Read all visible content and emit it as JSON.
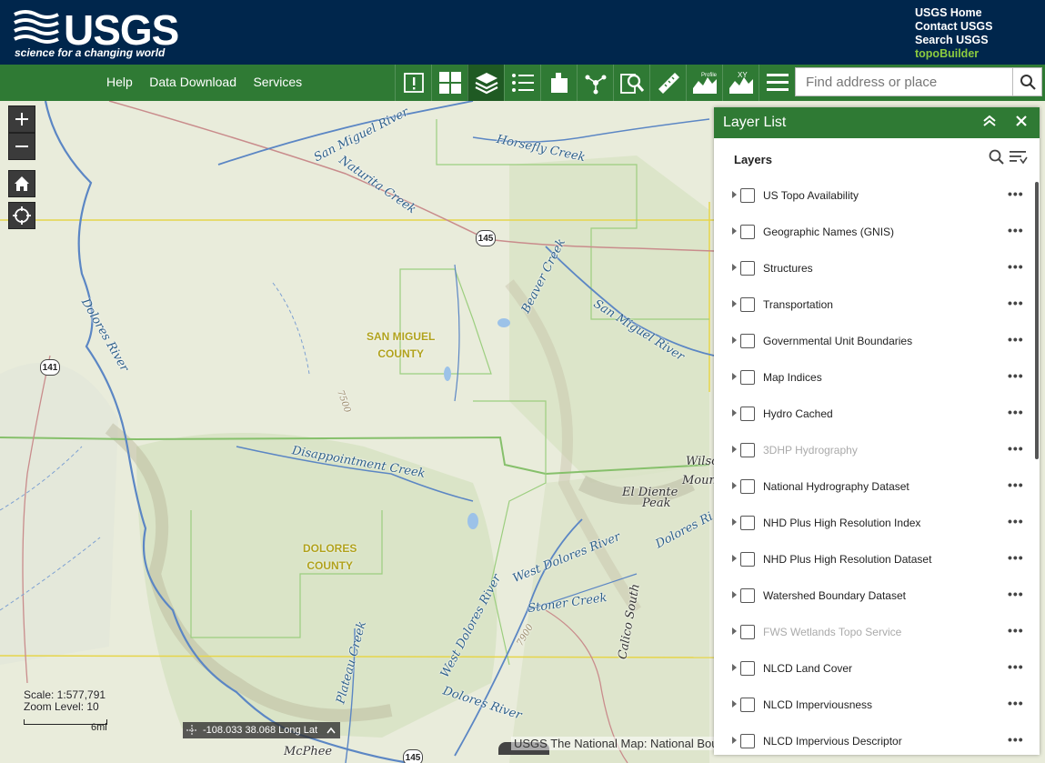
{
  "header": {
    "logo_word": "USGS",
    "logo_tagline": "science for a changing world",
    "links": [
      "USGS Home",
      "Contact USGS",
      "Search USGS"
    ],
    "highlight_link": "topoBuilder"
  },
  "nav": {
    "links": [
      "Help",
      "Data Download",
      "Services"
    ],
    "tools": [
      "alert-icon",
      "basemap-gallery-icon",
      "layer-list-icon",
      "legend-icon",
      "bookmark-icon",
      "share-icon",
      "query-icon",
      "measure-icon",
      "profile-icon",
      "xy-profile-icon",
      "menu-icon"
    ],
    "tool_labels": {
      "profile": "Profile",
      "xy": "XY"
    },
    "search_placeholder": "Find address or place"
  },
  "map": {
    "labels": {
      "san_miguel_river": "San Miguel River",
      "horsefly_creek": "Horsefly Creek",
      "naturita_creek": "Naturita Creek",
      "beaver_creek": "Beaver Creek",
      "san_miguel_river_2": "San Miguel River",
      "dolores_river": "Dolores River",
      "disappointment_creek": "Disappointment Creek",
      "west_dolores_river": "West Dolores River",
      "west_dolores_river_2": "West Dolores River",
      "stoner_creek": "Stoner Creek",
      "plateau_creek": "Plateau Creek",
      "dolores_river_2": "Dolores River",
      "dolores_river_3": "Dolores Ri",
      "el_diente": "El Diente",
      "peak": "Peak",
      "wilso": "Wilso",
      "mount": "Mount",
      "calico_south": "Calico South",
      "mcphee": "McPhee",
      "elev_7500": "7500",
      "elev_7900": "7900"
    },
    "counties": {
      "san_miguel_1": "SAN MIGUEL",
      "san_miguel_2": "COUNTY",
      "dolores_1": "DOLORES",
      "dolores_2": "COUNTY"
    },
    "routes": [
      "145",
      "141",
      "145"
    ],
    "scale": "Scale: 1:577,791",
    "zoom": "Zoom Level: 10",
    "scalebar_label": "6mi",
    "coordinates": "-108.033 38.068 Long Lat",
    "attribution": "USGS The National Map: National Bou"
  },
  "panel": {
    "title": "Layer List",
    "subtitle": "Layers",
    "layers": [
      {
        "name": "US Topo Availability",
        "dim": false
      },
      {
        "name": "Geographic Names (GNIS)",
        "dim": false
      },
      {
        "name": "Structures",
        "dim": false
      },
      {
        "name": "Transportation",
        "dim": false
      },
      {
        "name": "Governmental Unit Boundaries",
        "dim": false
      },
      {
        "name": "Map Indices",
        "dim": false
      },
      {
        "name": "Hydro Cached",
        "dim": false
      },
      {
        "name": "3DHP Hydrography",
        "dim": true
      },
      {
        "name": "National Hydrography Dataset",
        "dim": false
      },
      {
        "name": "NHD Plus High Resolution Index",
        "dim": false
      },
      {
        "name": "NHD Plus High Resolution Dataset",
        "dim": false
      },
      {
        "name": "Watershed Boundary Dataset",
        "dim": false
      },
      {
        "name": "FWS Wetlands Topo Service",
        "dim": true
      },
      {
        "name": "NLCD Land Cover",
        "dim": false
      },
      {
        "name": "NLCD Imperviousness",
        "dim": false
      },
      {
        "name": "NLCD Impervious Descriptor",
        "dim": false
      }
    ]
  }
}
